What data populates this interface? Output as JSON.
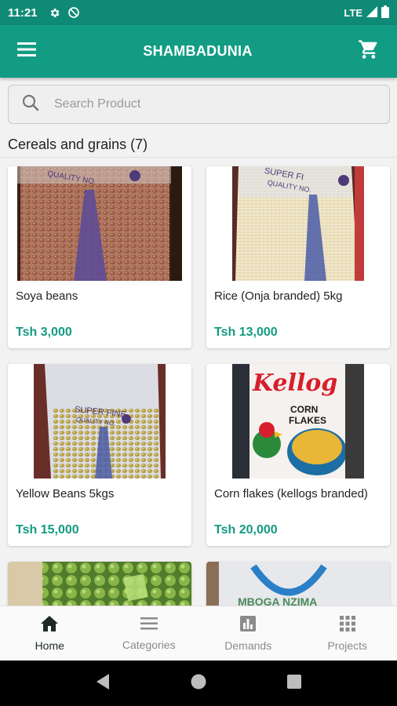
{
  "status_bar": {
    "time": "11:21",
    "network": "LTE"
  },
  "app": {
    "title": "SHAMBADUNIA"
  },
  "search": {
    "placeholder": "Search Product"
  },
  "section": {
    "title": "Cereals and grains (7)"
  },
  "products": [
    {
      "name": "Soya beans",
      "price": "Tsh 3,000"
    },
    {
      "name": "Rice (Onja branded) 5kg",
      "price": "Tsh 13,000"
    },
    {
      "name": "Yellow Beans 5kgs",
      "price": "Tsh 15,000"
    },
    {
      "name": "Corn flakes (kellogs branded)",
      "price": "Tsh 20,000"
    }
  ],
  "nav": {
    "home": "Home",
    "categories": "Categories",
    "demands": "Demands",
    "projects": "Projects"
  },
  "colors": {
    "primary": "#129c84",
    "price": "#139a82",
    "background": "#f2f2f2"
  }
}
